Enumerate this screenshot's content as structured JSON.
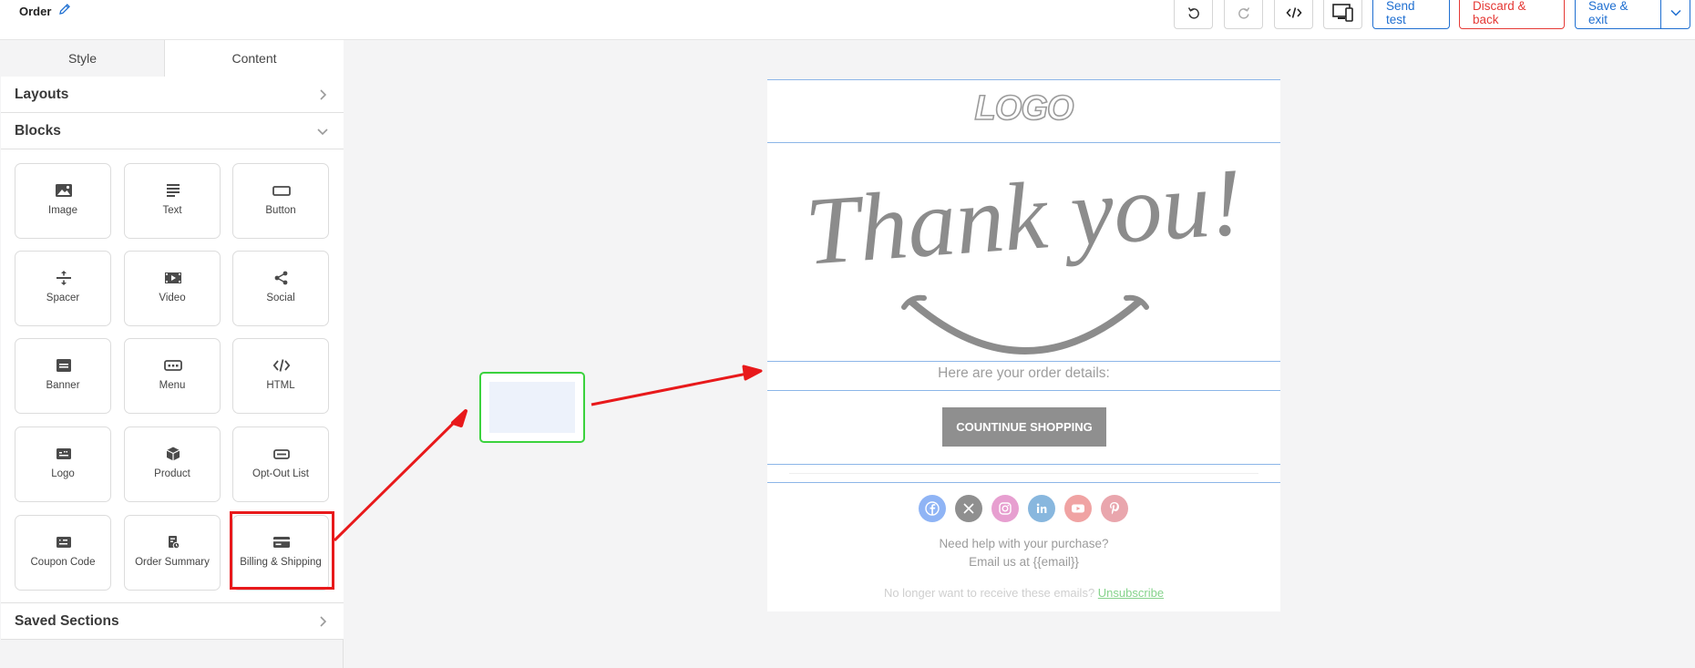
{
  "header": {
    "title": "Order",
    "send_test": "Send test",
    "discard": "Discard & back",
    "save_exit": "Save & exit"
  },
  "sidebar": {
    "tabs": [
      "Style",
      "Content"
    ],
    "active_tab": "Content",
    "layouts_label": "Layouts",
    "blocks_label": "Blocks",
    "saved_sections_label": "Saved Sections",
    "blocks": [
      {
        "label": "Image",
        "icon": "image-icon"
      },
      {
        "label": "Text",
        "icon": "text-icon"
      },
      {
        "label": "Button",
        "icon": "button-icon"
      },
      {
        "label": "Spacer",
        "icon": "spacer-icon"
      },
      {
        "label": "Video",
        "icon": "video-icon"
      },
      {
        "label": "Social",
        "icon": "share-icon"
      },
      {
        "label": "Banner",
        "icon": "banner-icon"
      },
      {
        "label": "Menu",
        "icon": "menu-icon"
      },
      {
        "label": "HTML",
        "icon": "code-icon"
      },
      {
        "label": "Logo",
        "icon": "logo-icon"
      },
      {
        "label": "Product",
        "icon": "product-icon"
      },
      {
        "label": "Opt-Out List",
        "icon": "optout-icon"
      },
      {
        "label": "Coupon Code",
        "icon": "coupon-icon"
      },
      {
        "label": "Order Summary",
        "icon": "order-summary-icon"
      },
      {
        "label": "Billing & Shipping",
        "icon": "card-icon"
      }
    ]
  },
  "email": {
    "logo_text": "LOGO",
    "hero_text": "Thank you!",
    "order_details": "Here are your order details:",
    "button_label": "COUNTINUE SHOPPING",
    "help_line1": "Need help with your purchase?",
    "help_line2": "Email us at {{email}}",
    "unsub_prefix": "No longer want to receive these emails?",
    "unsub_link": "Unsubscribe",
    "socials": [
      {
        "name": "facebook",
        "color": "#8fb4f5"
      },
      {
        "name": "x",
        "color": "#8f8f8f"
      },
      {
        "name": "instagram",
        "color": "#e79fd0"
      },
      {
        "name": "linkedin",
        "color": "#88b7de"
      },
      {
        "name": "youtube",
        "color": "#f0a3a3"
      },
      {
        "name": "pinterest",
        "color": "#e9a6ad"
      }
    ]
  },
  "colors": {
    "accent_blue": "#1f6fd1",
    "danger_red": "#e53935",
    "annotation_red": "#e8191b",
    "drop_green": "#3bd23d"
  }
}
